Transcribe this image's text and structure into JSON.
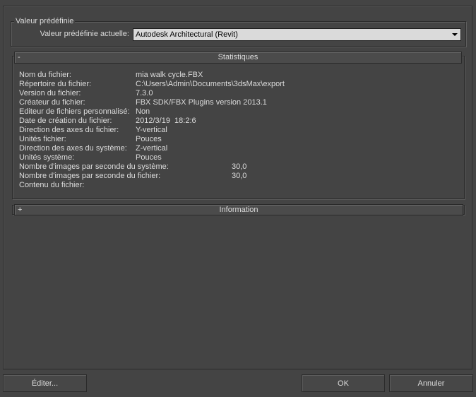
{
  "theme": {
    "background": "#444444",
    "text": "#dcdcdc",
    "dropdown_background": "#dadada",
    "dropdown_text": "#000000"
  },
  "preset": {
    "group_title": "Valeur prédéfinie",
    "current_label": "Valeur prédéfinie actuelle:",
    "current_value": "Autodesk Architectural (Revit)",
    "dropdown_icon": "triangle-down-icon"
  },
  "statistics": {
    "expanded": true,
    "toggle_symbol": "-",
    "title": "Statistiques",
    "rows": [
      {
        "label": "Nom du fichier:",
        "value": "mia walk cycle.FBX"
      },
      {
        "label": "Répertoire du fichier:",
        "value": "C:\\Users\\Admin\\Documents\\3dsMax\\export"
      },
      {
        "label": "Version du fichier:",
        "value": "7.3.0"
      },
      {
        "label": "Créateur du fichier:",
        "value": "FBX SDK/FBX Plugins version 2013.1"
      },
      {
        "label": "Editeur de fichiers personnalisé:",
        "value": "Non"
      },
      {
        "label": "Date de création du fichier:",
        "value": "2012/3/19  18:2:6"
      },
      {
        "label": "Direction des axes du fichier:",
        "value": "Y-vertical"
      },
      {
        "label": "Unités fichier:",
        "value": "Pouces"
      },
      {
        "label": "Direction des axes du système:",
        "value": "Z-vertical"
      },
      {
        "label": "Unités système:",
        "value": "Pouces"
      },
      {
        "label": "Nombre d'images par seconde du système:",
        "value": "30,0"
      },
      {
        "label": "Nombre d'images par seconde du fichier:",
        "value": "30,0"
      },
      {
        "label": "Contenu du fichier:"
      }
    ]
  },
  "information": {
    "expanded": false,
    "toggle_symbol": "+",
    "title": "Information"
  },
  "buttons": {
    "edit": "Éditer...",
    "ok": "OK",
    "cancel": "Annuler"
  }
}
